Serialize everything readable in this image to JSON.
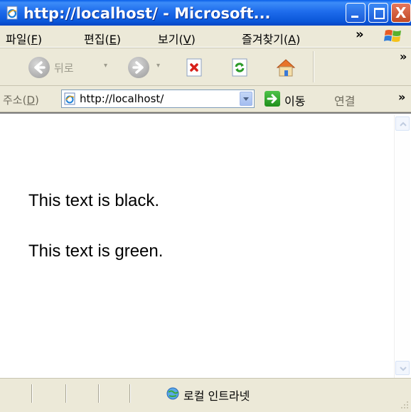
{
  "window": {
    "title": "http://localhost/ - Microsoft..."
  },
  "titlebar_buttons": {
    "close_glyph": "X"
  },
  "menubar": {
    "items": [
      {
        "label": "파일(",
        "key": "F",
        "suffix": ")"
      },
      {
        "label": "편집(",
        "key": "E",
        "suffix": ")"
      },
      {
        "label": "보기(",
        "key": "V",
        "suffix": ")"
      },
      {
        "label": "즐겨찾기(",
        "key": "A",
        "suffix": ")"
      }
    ],
    "more": "»"
  },
  "toolbar": {
    "back_label": "뒤로",
    "dropdown_glyph": "▾",
    "more": "»"
  },
  "addressbar": {
    "label_prefix": "주소(",
    "label_key": "D",
    "label_suffix": ")",
    "url": "http://localhost/",
    "go_label": "이동",
    "links_label": "연결",
    "more": "»"
  },
  "content": {
    "lines": [
      {
        "text": "This text is black.",
        "color": "#000000"
      },
      {
        "text": "This text is green.",
        "color": "#000000"
      }
    ]
  },
  "statusbar": {
    "zone_text": "로컬 인트라넷"
  },
  "icons": {
    "app": "ie-page-icon",
    "back": "back-arrow-icon",
    "forward": "forward-arrow-icon",
    "stop": "stop-icon",
    "refresh": "refresh-icon",
    "home": "home-icon",
    "go": "go-arrow-icon",
    "zone": "intranet-globe-icon"
  },
  "colors": {
    "titlebar": "#0A56D8",
    "chrome": "#ECE9D8",
    "close": "#C24A26"
  }
}
